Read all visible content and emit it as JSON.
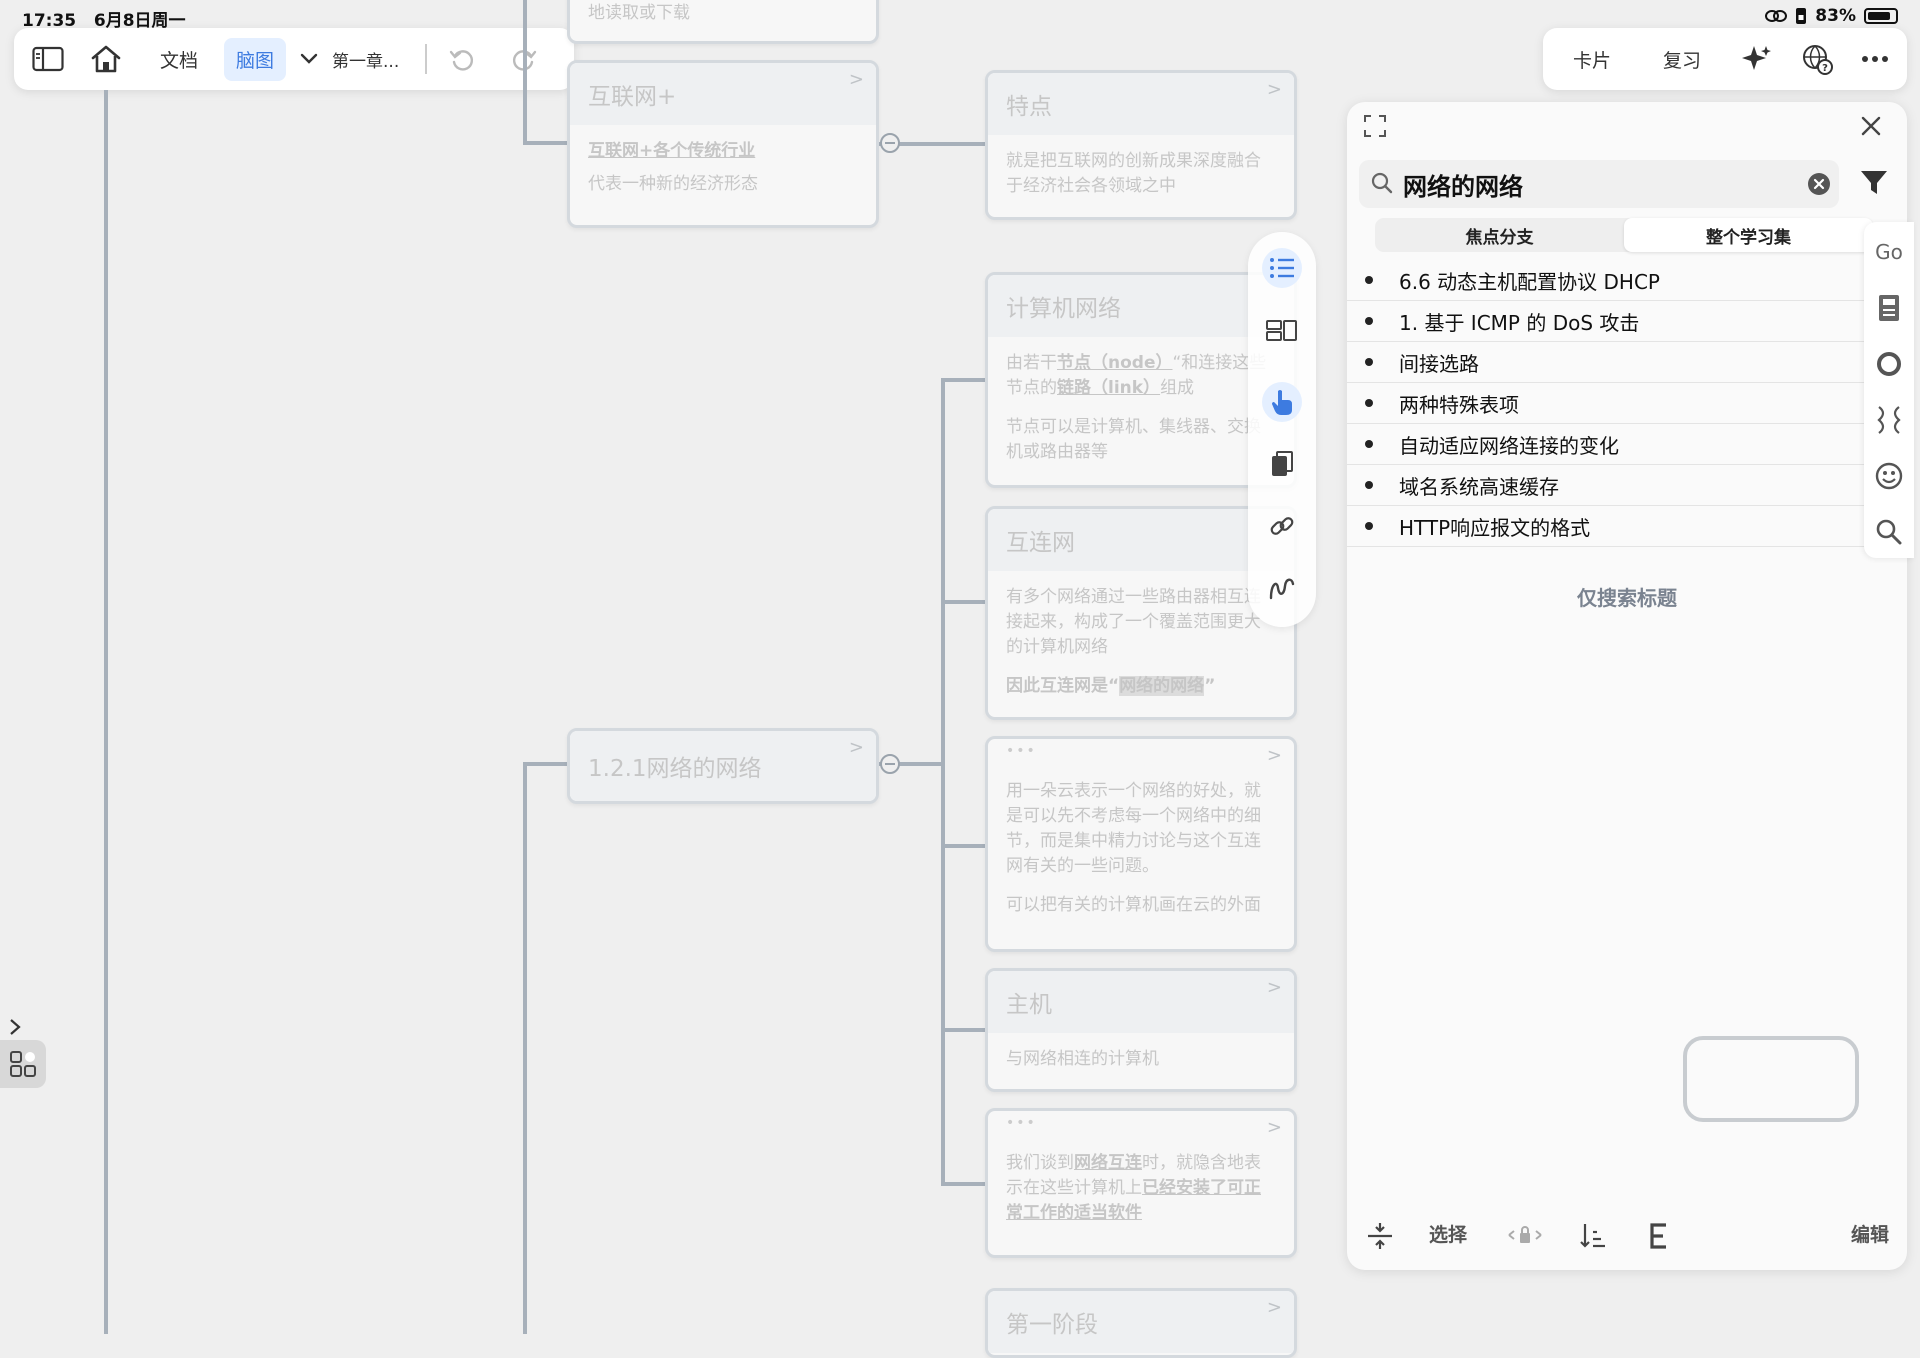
{
  "status": {
    "time": "17:35",
    "date": "6月8日周一",
    "battery": "83%",
    "battery_level": 0.83
  },
  "toolbar_left": {
    "doc": "文档",
    "mindmap": "脑图",
    "chapter": "第一章..."
  },
  "toolbar_right": {
    "cards": "卡片",
    "review": "复习"
  },
  "mindmap": {
    "top_partial": "地读取或下载",
    "internet_plus": {
      "title": "互联网+",
      "line1": "互联网+各个传统行业",
      "line2": "代表一种新的经济形态"
    },
    "feature": {
      "title": "特点",
      "body": "就是把互联网的创新成果深度融合于经济社会各领域之中"
    },
    "network_of_networks": {
      "title": "1.2.1网络的网络"
    },
    "computer_network": {
      "title": "计算机网络",
      "p1_a": "由若干",
      "p1_node": "节点（node）",
      "p1_b": "“和连接这些节点的",
      "p1_link": "链路（link）",
      "p1_c": "组成",
      "p2": "节点可以是计算机、集线器、交换机或路由器等"
    },
    "interconnect": {
      "title": "互连网",
      "p1": "有多个网络通过一些路由器相互连接起来，构成了一个覆盖范围更大的计算机网络",
      "p2_a": "因此互连网是“",
      "p2_hl": "网络的网络",
      "p2_b": "”"
    },
    "cloud_note": {
      "dots": "•••",
      "p1": "用一朵云表示一个网络的好处，就是可以先不考虑每一个网络中的细节，而是集中精力讨论与这个互连网有关的一些问题。",
      "p2": "可以把有关的计算机画在云的外面"
    },
    "host": {
      "title": "主机",
      "body": "与网络相连的计算机"
    },
    "interconnect_note": {
      "dots": "•••",
      "a": "我们谈到",
      "b": "网络互连",
      "c": "时，就隐含地表示在这些计算机上",
      "d": "已经安装了可正常工作的适当软件"
    },
    "stage_one": {
      "title": "第一阶段"
    }
  },
  "search": {
    "query": "网络的网络",
    "seg_focus": "焦点分支",
    "seg_all": "整个学习集",
    "results": [
      "6.6 动态主机配置协议 DHCP",
      "1. 基于 ICMP 的 DoS 攻击",
      "间接选路",
      "两种特殊表项",
      "自动适应网络连接的变化",
      "域名系统高速缓存",
      "HTTP响应报文的格式"
    ],
    "only_titles": "仅搜索标题",
    "select": "选择",
    "edit": "编辑"
  },
  "right_rail": {
    "go": "Go"
  },
  "colors": {
    "accent": "#3d7be0",
    "line": "#a7b0ba",
    "node_border": "#d4d9de"
  }
}
